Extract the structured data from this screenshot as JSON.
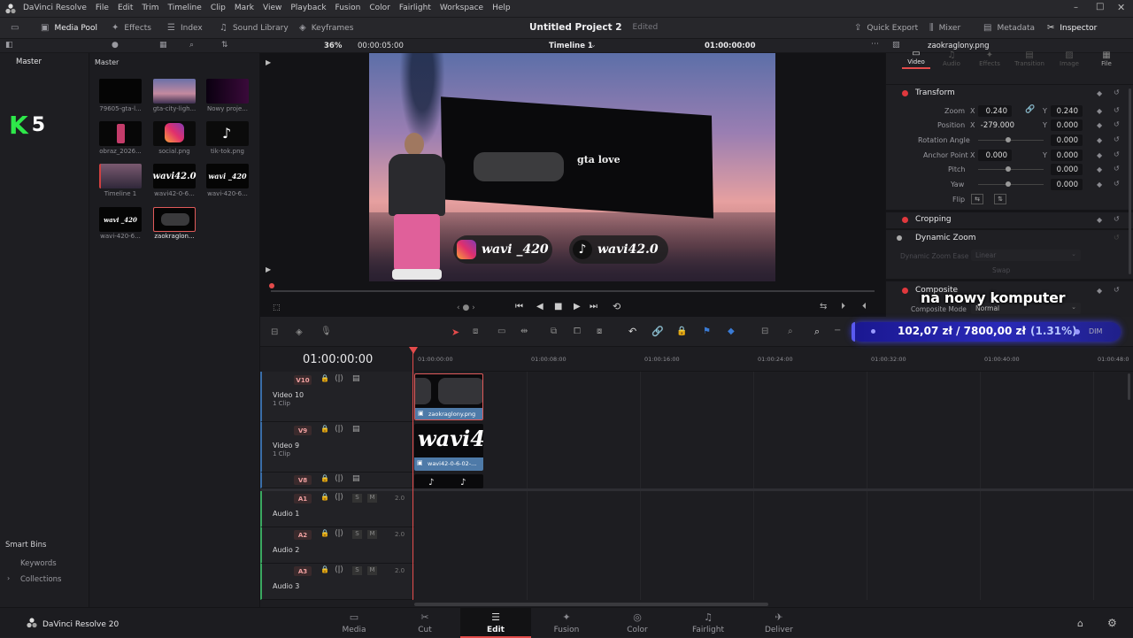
{
  "menubar": {
    "app_name": "DaVinci Resolve",
    "items": [
      "File",
      "Edit",
      "Trim",
      "Timeline",
      "Clip",
      "Mark",
      "View",
      "Playback",
      "Fusion",
      "Color",
      "Fairlight",
      "Workspace",
      "Help"
    ]
  },
  "toolbar": {
    "media_pool": "Media Pool",
    "effects": "Effects",
    "index": "Index",
    "sound_library": "Sound Library",
    "keyframes": "Keyframes",
    "project_title": "Untitled Project 2",
    "project_status": "Edited",
    "quick_export": "Quick Export",
    "mixer": "Mixer",
    "metadata": "Metadata",
    "inspector": "Inspector"
  },
  "viewer_bar": {
    "zoom": "36%",
    "duration": "00:00:05:00",
    "timeline_name": "Timeline 1",
    "timecode": "01:00:00:00",
    "clip_name": "zaokraglony.png"
  },
  "bins": {
    "master": "Master",
    "smart_bins": "Smart Bins",
    "keywords": "Keywords",
    "collections": "Collections",
    "overlay_logo": "K",
    "overlay_number": "5"
  },
  "pool": {
    "header": "Master",
    "clips": [
      {
        "label": "79605-gta-l..."
      },
      {
        "label": "gta-city-ligh..."
      },
      {
        "label": "Nowy proje..."
      },
      {
        "label": "obraz_2026..."
      },
      {
        "label": "social.png"
      },
      {
        "label": "tik-tok.png"
      },
      {
        "label": "Timeline 1"
      },
      {
        "label": "wavi42-0-6..."
      },
      {
        "label": "wavi-420-6..."
      },
      {
        "label": "wavi-420-6..."
      },
      {
        "label": "zaokraglon..."
      }
    ],
    "thumb_text": {
      "wavi1": "wavi42.0",
      "wavi2": "wavi _420",
      "wavi3": "wavi _420"
    }
  },
  "viewer": {
    "gta_text": "gta love",
    "instagram_handle": "wavi _420",
    "tiktok_handle": "wavi42.0"
  },
  "inspector": {
    "tabs": [
      "Video",
      "Audio",
      "Effects",
      "Transition",
      "Image",
      "File"
    ],
    "transform": "Transform",
    "zoom_label": "Zoom",
    "zoom_x": "0.240",
    "zoom_y": "0.240",
    "position_label": "Position",
    "position_x": "-279.000",
    "position_y": "0.000",
    "rotation_label": "Rotation Angle",
    "rotation_value": "0.000",
    "anchor_label": "Anchor Point",
    "anchor_x": "0.000",
    "anchor_y": "0.000",
    "pitch_label": "Pitch",
    "pitch_value": "0.000",
    "yaw_label": "Yaw",
    "yaw_value": "0.000",
    "flip_label": "Flip",
    "x": "X",
    "y": "Y",
    "cropping": "Cropping",
    "dynamic_zoom": "Dynamic Zoom",
    "dynamic_zoom_ease": "Dynamic Zoom Ease",
    "linear": "Linear",
    "swap": "Swap",
    "composite": "Composite",
    "composite_mode": "Composite Mode",
    "normal": "Normal"
  },
  "overlay": {
    "caption": "na nowy komputer",
    "progress_text": "102,07 zł / 7800,00 zł",
    "progress_percent_text": "(1.31%)",
    "progress_fraction": 0.0131,
    "dim": "DIM"
  },
  "timeline": {
    "timecode": "01:00:00:00",
    "ruler": [
      "01:00:00:00",
      "01:00:08:00",
      "01:00:16:00",
      "01:00:24:00",
      "01:00:32:00",
      "01:00:40:00",
      "01:00:48:0"
    ],
    "tracks": [
      {
        "id": "V10",
        "name": "Video 10",
        "sub": "1 Clip",
        "clip": "zaokraglony.png"
      },
      {
        "id": "V9",
        "name": "Video 9",
        "sub": "1 Clip",
        "clip": "wavi42-0-6-02-..."
      },
      {
        "id": "V8",
        "name": "",
        "sub": "",
        "clip": ""
      }
    ],
    "audio": [
      {
        "id": "A1",
        "name": "Audio 1",
        "ch": "2.0"
      },
      {
        "id": "A2",
        "name": "Audio 2",
        "ch": "2.0"
      },
      {
        "id": "A3",
        "name": "Audio 3",
        "ch": "2.0"
      }
    ],
    "clip_wavi_text": "wavi4",
    "s": "S",
    "m": "M"
  },
  "pages": {
    "brand": "DaVinci Resolve 20",
    "items": [
      "Media",
      "Cut",
      "Edit",
      "Fusion",
      "Color",
      "Fairlight",
      "Deliver"
    ]
  },
  "colors": {
    "accent_red": "#e34b4b",
    "overlay_blue": "#1d1aa8",
    "logo_green": "#2ee84a"
  }
}
